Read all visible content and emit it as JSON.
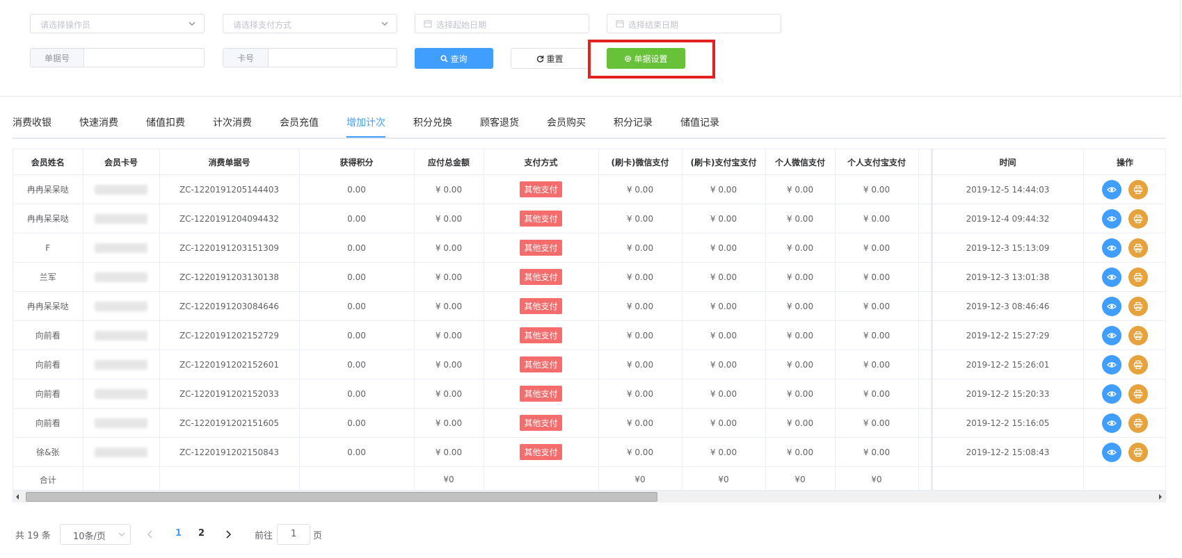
{
  "filters": {
    "operator_placeholder": "请选择操作员",
    "payment_placeholder": "请选择支付方式",
    "start_date_placeholder": "选择起始日期",
    "end_date_placeholder": "选择结束日期",
    "order_no_label": "单据号",
    "order_no_value": "",
    "card_no_label": "卡号",
    "card_no_value": "",
    "query_label": "查询",
    "reset_label": "重置",
    "settings_label": "单据设置",
    "highlight_color": "#e42121"
  },
  "tabs": [
    {
      "label": "消费收银"
    },
    {
      "label": "快速消费"
    },
    {
      "label": "储值扣费"
    },
    {
      "label": "计次消费"
    },
    {
      "label": "会员充值"
    },
    {
      "label": "增加计次",
      "active": true
    },
    {
      "label": "积分兑换"
    },
    {
      "label": "顾客退货"
    },
    {
      "label": "会员购买"
    },
    {
      "label": "积分记录"
    },
    {
      "label": "储值记录"
    }
  ],
  "table": {
    "headers": {
      "name": "会员姓名",
      "card": "会员卡号",
      "order": "消费单据号",
      "points": "获得积分",
      "total": "应付总金额",
      "pay": "支付方式",
      "wx_card": "(刷卡)微信支付",
      "ali_card": "(刷卡)支付宝支付",
      "wx_personal": "个人微信支付",
      "ali_personal": "个人支付宝支付",
      "time": "时间",
      "ops": "操作"
    },
    "rows": [
      {
        "name": "冉冉呆呆哒",
        "order": "ZC-1220191205144403",
        "points": "0.00",
        "total": "¥ 0.00",
        "pay": "其他支付",
        "wx_card": "¥ 0.00",
        "ali_card": "¥ 0.00",
        "wx_personal": "¥ 0.00",
        "ali_personal": "¥ 0.00",
        "time": "2019-12-5 14:44:03"
      },
      {
        "name": "冉冉呆呆哒",
        "order": "ZC-1220191204094432",
        "points": "0.00",
        "total": "¥ 0.00",
        "pay": "其他支付",
        "wx_card": "¥ 0.00",
        "ali_card": "¥ 0.00",
        "wx_personal": "¥ 0.00",
        "ali_personal": "¥ 0.00",
        "time": "2019-12-4 09:44:32"
      },
      {
        "name": "F",
        "order": "ZC-1220191203151309",
        "points": "0.00",
        "total": "¥ 0.00",
        "pay": "其他支付",
        "wx_card": "¥ 0.00",
        "ali_card": "¥ 0.00",
        "wx_personal": "¥ 0.00",
        "ali_personal": "¥ 0.00",
        "time": "2019-12-3 15:13:09"
      },
      {
        "name": "兰军",
        "order": "ZC-1220191203130138",
        "points": "0.00",
        "total": "¥ 0.00",
        "pay": "其他支付",
        "wx_card": "¥ 0.00",
        "ali_card": "¥ 0.00",
        "wx_personal": "¥ 0.00",
        "ali_personal": "¥ 0.00",
        "time": "2019-12-3 13:01:38"
      },
      {
        "name": "冉冉呆呆哒",
        "order": "ZC-1220191203084646",
        "points": "0.00",
        "total": "¥ 0.00",
        "pay": "其他支付",
        "wx_card": "¥ 0.00",
        "ali_card": "¥ 0.00",
        "wx_personal": "¥ 0.00",
        "ali_personal": "¥ 0.00",
        "time": "2019-12-3 08:46:46"
      },
      {
        "name": "向前看",
        "order": "ZC-1220191202152729",
        "points": "0.00",
        "total": "¥ 0.00",
        "pay": "其他支付",
        "wx_card": "¥ 0.00",
        "ali_card": "¥ 0.00",
        "wx_personal": "¥ 0.00",
        "ali_personal": "¥ 0.00",
        "time": "2019-12-2 15:27:29"
      },
      {
        "name": "向前看",
        "order": "ZC-1220191202152601",
        "points": "0.00",
        "total": "¥ 0.00",
        "pay": "其他支付",
        "wx_card": "¥ 0.00",
        "ali_card": "¥ 0.00",
        "wx_personal": "¥ 0.00",
        "ali_personal": "¥ 0.00",
        "time": "2019-12-2 15:26:01"
      },
      {
        "name": "向前看",
        "order": "ZC-1220191202152033",
        "points": "0.00",
        "total": "¥ 0.00",
        "pay": "其他支付",
        "wx_card": "¥ 0.00",
        "ali_card": "¥ 0.00",
        "wx_personal": "¥ 0.00",
        "ali_personal": "¥ 0.00",
        "time": "2019-12-2 15:20:33"
      },
      {
        "name": "向前看",
        "order": "ZC-1220191202151605",
        "points": "0.00",
        "total": "¥ 0.00",
        "pay": "其他支付",
        "wx_card": "¥ 0.00",
        "ali_card": "¥ 0.00",
        "wx_personal": "¥ 0.00",
        "ali_personal": "¥ 0.00",
        "time": "2019-12-2 15:16:05"
      },
      {
        "name": "徐&张",
        "order": "ZC-1220191202150843",
        "points": "0.00",
        "total": "¥ 0.00",
        "pay": "其他支付",
        "wx_card": "¥ 0.00",
        "ali_card": "¥ 0.00",
        "wx_personal": "¥ 0.00",
        "ali_personal": "¥ 0.00",
        "time": "2019-12-2 15:08:43"
      }
    ],
    "summary": {
      "label": "合计",
      "total": "¥0",
      "wx_card": "¥0",
      "ali_card": "¥0",
      "wx_personal": "¥0",
      "ali_personal": "¥0"
    }
  },
  "pagination": {
    "total_text": "共 19 条",
    "page_size": "10条/页",
    "pages": [
      "1",
      "2"
    ],
    "current_page": "1",
    "goto_label": "前往",
    "goto_value": "1",
    "page_suffix": "页"
  }
}
